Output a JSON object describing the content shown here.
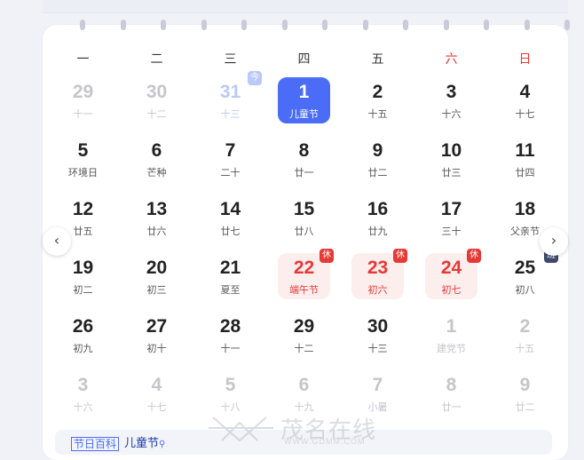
{
  "weekdays": [
    {
      "label": "一",
      "weekend": false
    },
    {
      "label": "二",
      "weekend": false
    },
    {
      "label": "三",
      "weekend": false
    },
    {
      "label": "四",
      "weekend": false
    },
    {
      "label": "五",
      "weekend": false
    },
    {
      "label": "六",
      "weekend": true
    },
    {
      "label": "日",
      "weekend": true
    }
  ],
  "weeks": [
    [
      {
        "day": "29",
        "lunar": "十一",
        "state": "muted"
      },
      {
        "day": "30",
        "lunar": "十二",
        "state": "muted"
      },
      {
        "day": "31",
        "lunar": "十三",
        "state": "prev-today",
        "badge": "今",
        "badge_type": "todaytag"
      },
      {
        "day": "1",
        "lunar": "儿童节",
        "state": "today"
      },
      {
        "day": "2",
        "lunar": "十五",
        "state": "normal"
      },
      {
        "day": "3",
        "lunar": "十六",
        "state": "normal"
      },
      {
        "day": "4",
        "lunar": "十七",
        "state": "normal"
      }
    ],
    [
      {
        "day": "5",
        "lunar": "环境日",
        "state": "normal"
      },
      {
        "day": "6",
        "lunar": "芒种",
        "state": "normal"
      },
      {
        "day": "7",
        "lunar": "二十",
        "state": "normal"
      },
      {
        "day": "8",
        "lunar": "廿一",
        "state": "normal"
      },
      {
        "day": "9",
        "lunar": "廿二",
        "state": "normal"
      },
      {
        "day": "10",
        "lunar": "廿三",
        "state": "normal"
      },
      {
        "day": "11",
        "lunar": "廿四",
        "state": "normal"
      }
    ],
    [
      {
        "day": "12",
        "lunar": "廿五",
        "state": "normal"
      },
      {
        "day": "13",
        "lunar": "廿六",
        "state": "normal"
      },
      {
        "day": "14",
        "lunar": "廿七",
        "state": "normal"
      },
      {
        "day": "15",
        "lunar": "廿八",
        "state": "normal"
      },
      {
        "day": "16",
        "lunar": "廿九",
        "state": "normal"
      },
      {
        "day": "17",
        "lunar": "三十",
        "state": "normal"
      },
      {
        "day": "18",
        "lunar": "父亲节",
        "state": "normal"
      }
    ],
    [
      {
        "day": "19",
        "lunar": "初二",
        "state": "normal"
      },
      {
        "day": "20",
        "lunar": "初三",
        "state": "normal"
      },
      {
        "day": "21",
        "lunar": "夏至",
        "state": "normal"
      },
      {
        "day": "22",
        "lunar": "端午节",
        "state": "holiday",
        "badge": "休",
        "badge_type": "rest"
      },
      {
        "day": "23",
        "lunar": "初六",
        "state": "holiday",
        "badge": "休",
        "badge_type": "rest"
      },
      {
        "day": "24",
        "lunar": "初七",
        "state": "holiday",
        "badge": "休",
        "badge_type": "rest"
      },
      {
        "day": "25",
        "lunar": "初八",
        "state": "normal",
        "badge": "班",
        "badge_type": "work"
      }
    ],
    [
      {
        "day": "26",
        "lunar": "初九",
        "state": "normal"
      },
      {
        "day": "27",
        "lunar": "初十",
        "state": "normal"
      },
      {
        "day": "28",
        "lunar": "十一",
        "state": "normal"
      },
      {
        "day": "29",
        "lunar": "十二",
        "state": "normal"
      },
      {
        "day": "30",
        "lunar": "十三",
        "state": "normal"
      },
      {
        "day": "1",
        "lunar": "建党节",
        "state": "muted"
      },
      {
        "day": "2",
        "lunar": "十五",
        "state": "muted"
      }
    ],
    [
      {
        "day": "3",
        "lunar": "十六",
        "state": "muted"
      },
      {
        "day": "4",
        "lunar": "十七",
        "state": "muted"
      },
      {
        "day": "5",
        "lunar": "十八",
        "state": "muted"
      },
      {
        "day": "6",
        "lunar": "十九",
        "state": "muted"
      },
      {
        "day": "7",
        "lunar": "小暑",
        "state": "muted"
      },
      {
        "day": "8",
        "lunar": "廿一",
        "state": "muted"
      },
      {
        "day": "9",
        "lunar": "廿二",
        "state": "muted"
      }
    ]
  ],
  "nav": {
    "prev_icon": "‹",
    "next_icon": "›"
  },
  "footer": {
    "tag": "节日百科",
    "holiday": "儿童节",
    "search_icon": "⚲"
  },
  "watermark": {
    "title": "茂名在线",
    "url": "WWW.GDMM.COM"
  },
  "colors": {
    "accent": "#4a6cf7",
    "holiday_red": "#e53935",
    "work_badge": "#3c4a6b"
  }
}
